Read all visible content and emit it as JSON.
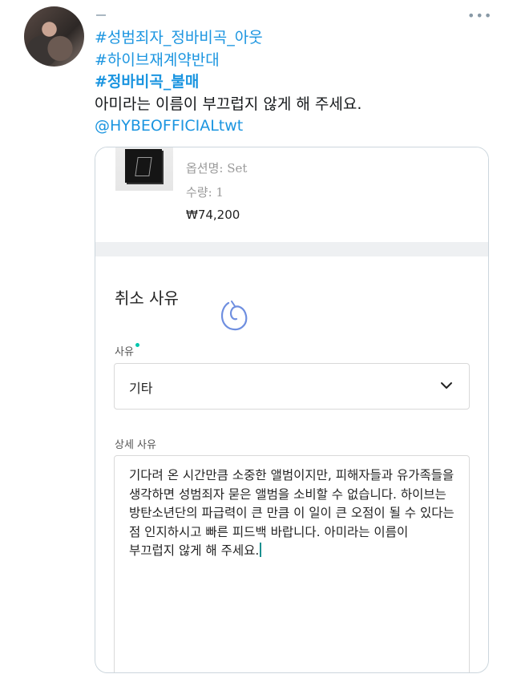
{
  "tweet": {
    "lines": [
      {
        "text": "#성범죄자_정바비곡_아웃",
        "kind": "hashtag"
      },
      {
        "text": "#하이브재계약반대",
        "kind": "hashtag"
      },
      {
        "text": "#정바비곡_불매",
        "kind": "hashtag-bold"
      },
      {
        "text": "아미라는 이름이 부끄럽지 않게 해 주세요.",
        "kind": "plain"
      },
      {
        "text": "@HYBEOFFICIALtwt",
        "kind": "mention"
      }
    ],
    "more_icon": "more-horizontal-icon",
    "link_color": "#1b95e0"
  },
  "order": {
    "option": "옵션명: Set",
    "quantity": "수량: 1",
    "price": "₩74,200"
  },
  "cancel": {
    "title": "취소 사유",
    "reason_label": "사유",
    "reason_value": "기타",
    "detail_label": "상세 사유",
    "detail_text": "기다려 온 시간만큼 소중한 앨범이지만, 피해자들과 유가족들을 생각하면 성범죄자 묻은 앨범을 소비할 수 없습니다. 하이브는 방탄소년단의 파급력이 큰 만큼 이 일이 큰 오점이 될 수 있다는 점 인지하시고 빠른 피드백 바랍니다. 아미라는 이름이 부끄럽지 않게 해 주세요.",
    "required_dot_color": "#00c7ae"
  }
}
